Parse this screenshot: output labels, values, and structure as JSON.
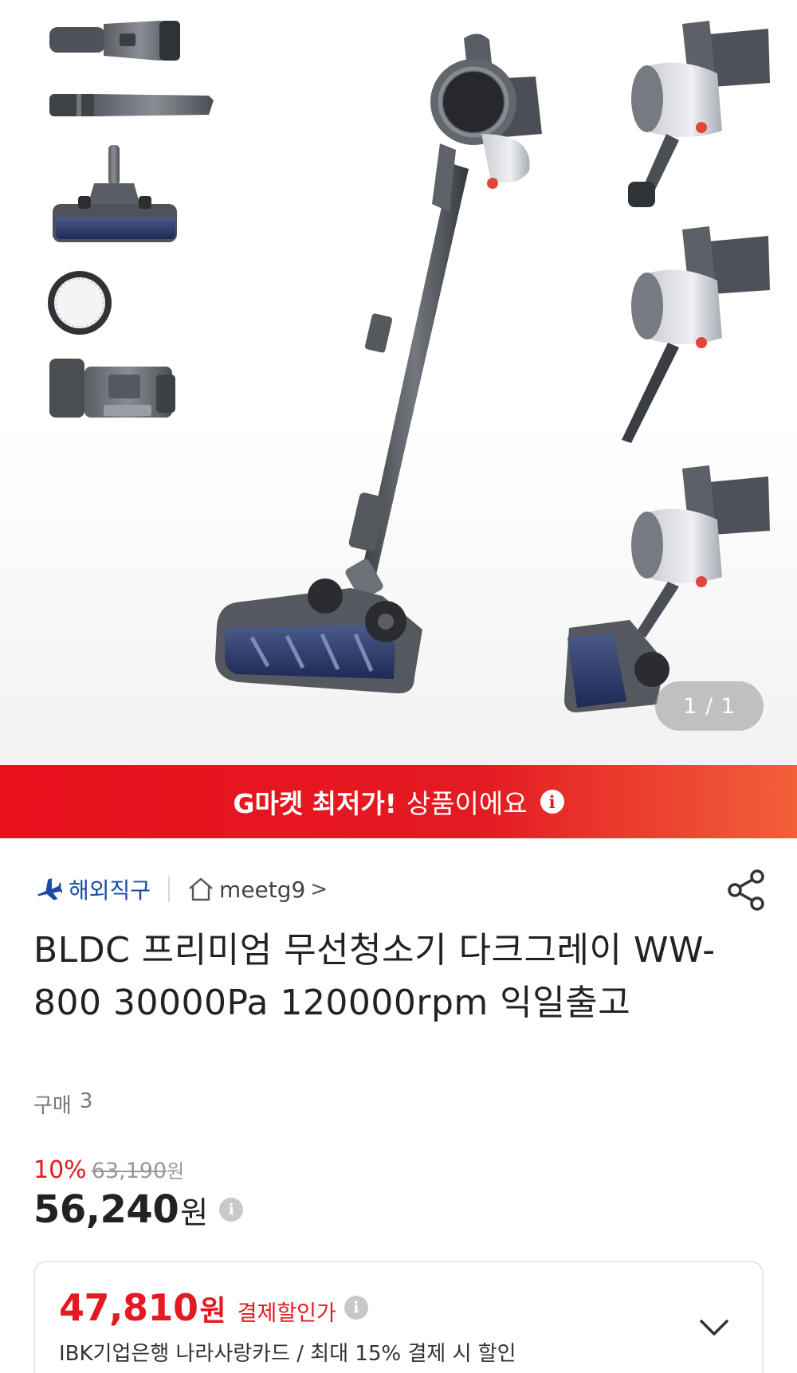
{
  "gallery": {
    "counter": "1 / 1"
  },
  "banner": {
    "strong": "G마켓 최저가!",
    "normal": "상품이에요",
    "info_icon": "info-icon"
  },
  "meta": {
    "badge_label": "해외직구",
    "badge_icon": "airplane-icon",
    "seller_name": "meetg9",
    "seller_icon": "home-icon",
    "seller_chevron": ">",
    "share_icon": "share-icon"
  },
  "product": {
    "title": "BLDC 프리미엄 무선청소기 다크그레이 WW-800 30000Pa 120000rpm 익일출고",
    "purchase_label": "구매",
    "purchase_count": "3"
  },
  "price": {
    "discount_rate": "10%",
    "original": "63,190",
    "original_unit": "원",
    "final": "56,240",
    "final_unit": "원"
  },
  "card_discount": {
    "price": "47,810",
    "unit": "원",
    "label": "결제할인가",
    "description": "IBK기업은행 나라사랑카드 / 최대 15% 결제 시 할인"
  },
  "colors": {
    "brand_red": "#e41a22",
    "badge_blue": "#1a4aa6",
    "text_dark": "#222222",
    "text_muted": "#777777"
  }
}
